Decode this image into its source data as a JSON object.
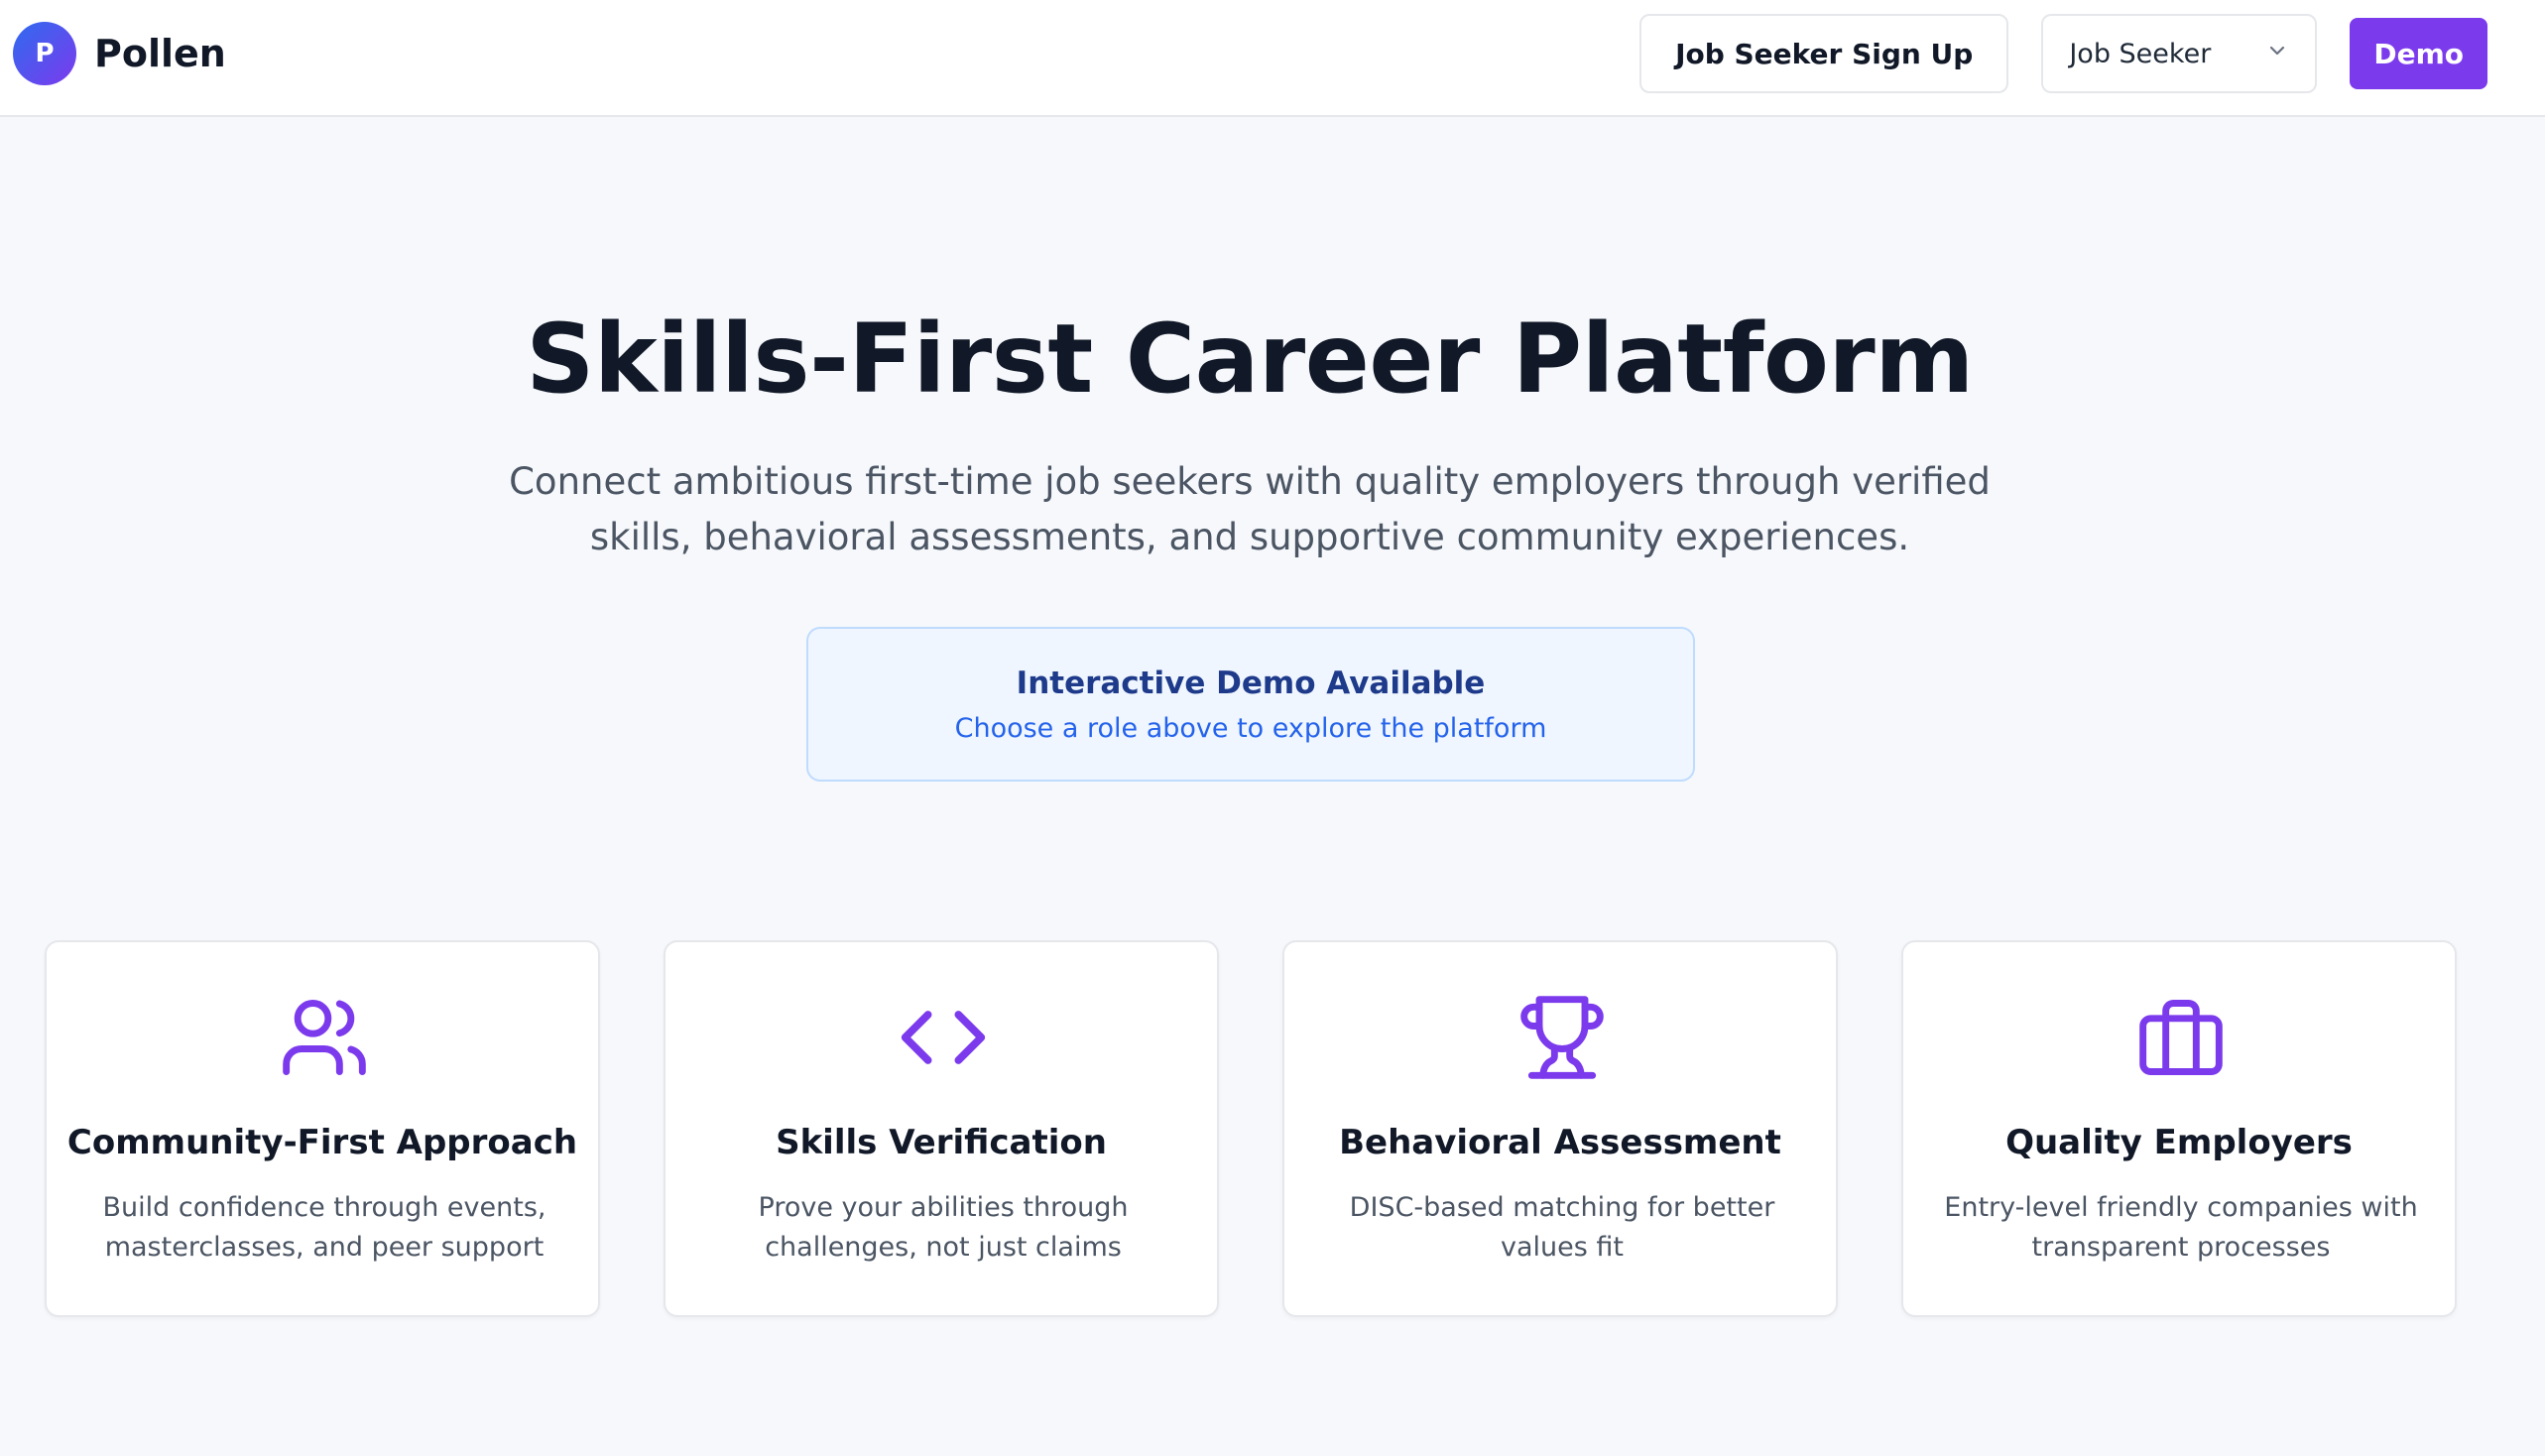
{
  "header": {
    "logo_letter": "P",
    "brand_name": "Pollen",
    "signup_label": "Job Seeker Sign Up",
    "role_select_value": "Job Seeker",
    "demo_label": "Demo"
  },
  "hero": {
    "title": "Skills-First Career Platform",
    "subtitle": "Connect ambitious first-time job seekers with quality employers through verified skills, behavioral assessments, and supportive community experiences."
  },
  "demo_notice": {
    "title": "Interactive Demo Available",
    "description": "Choose a role above to explore the platform"
  },
  "features": [
    {
      "icon": "users-icon",
      "title": "Community-First Approach",
      "description": "Build confidence through events, masterclasses, and peer support"
    },
    {
      "icon": "code-icon",
      "title": "Skills Verification",
      "description": "Prove your abilities through challenges, not just claims"
    },
    {
      "icon": "trophy-icon",
      "title": "Behavioral Assessment",
      "description": "DISC-based matching for better values fit"
    },
    {
      "icon": "briefcase-icon",
      "title": "Quality Employers",
      "description": "Entry-level friendly companies with transparent processes"
    }
  ],
  "colors": {
    "brand_purple": "#7c3aed",
    "logo_gradient_start": "#2f6bf0",
    "notice_bg": "#eff6ff",
    "notice_title": "#1e3a8a",
    "notice_text": "#2563eb",
    "page_bg": "#f6f8fb"
  }
}
